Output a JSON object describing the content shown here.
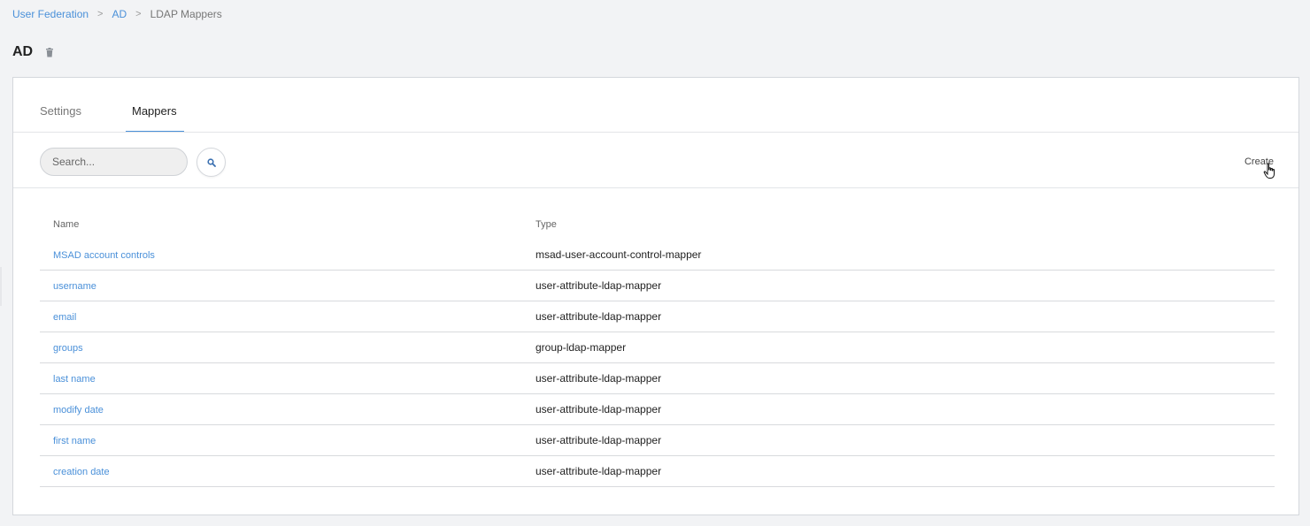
{
  "breadcrumb": {
    "items": [
      {
        "label": "User Federation"
      },
      {
        "label": "AD"
      }
    ],
    "current": "LDAP Mappers",
    "separator": ">"
  },
  "page": {
    "title": "AD",
    "delete_icon": "trash-icon"
  },
  "tabs": [
    {
      "label": "Settings",
      "active": false
    },
    {
      "label": "Mappers",
      "active": true
    }
  ],
  "toolbar": {
    "search_placeholder": "Search...",
    "search_icon": "search-icon",
    "create_label": "Create"
  },
  "table": {
    "headers": {
      "name": "Name",
      "type": "Type"
    },
    "rows": [
      {
        "name": "MSAD account controls",
        "type": "msad-user-account-control-mapper"
      },
      {
        "name": "username",
        "type": "user-attribute-ldap-mapper"
      },
      {
        "name": "email",
        "type": "user-attribute-ldap-mapper"
      },
      {
        "name": "groups",
        "type": "group-ldap-mapper"
      },
      {
        "name": "last name",
        "type": "user-attribute-ldap-mapper"
      },
      {
        "name": "modify date",
        "type": "user-attribute-ldap-mapper"
      },
      {
        "name": "first name",
        "type": "user-attribute-ldap-mapper"
      },
      {
        "name": "creation date",
        "type": "user-attribute-ldap-mapper"
      }
    ]
  },
  "colors": {
    "link": "#4a90d9",
    "background": "#f2f3f5",
    "card": "#ffffff",
    "tab_active_underline": "#4a90d9"
  }
}
